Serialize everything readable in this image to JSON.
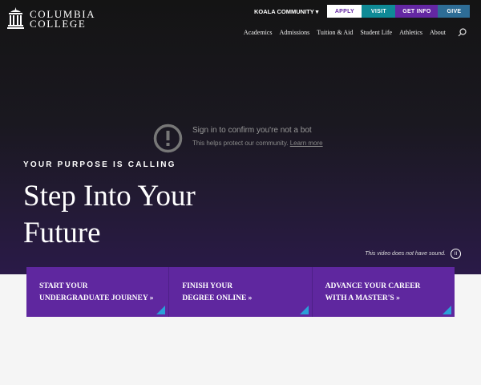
{
  "header": {
    "logo_line1": "COLUMBIA",
    "logo_line2": "COLLEGE",
    "community": "KOALA COMMUNITY ▾",
    "buttons": [
      {
        "label": "APPLY",
        "bg": "#ffffff",
        "fg": "#6427a3"
      },
      {
        "label": "VISIT",
        "bg": "#0f8a96",
        "fg": "#ffffff"
      },
      {
        "label": "GET INFO",
        "bg": "#6427a3",
        "fg": "#ffffff"
      },
      {
        "label": "GIVE",
        "bg": "#2e6d96",
        "fg": "#ffffff"
      }
    ],
    "nav": [
      "Academics",
      "Admissions",
      "Tuition & Aid",
      "Student Life",
      "Athletics",
      "About"
    ]
  },
  "video": {
    "title": "Sign in to confirm you're not a bot",
    "subtitle": "This helps protect our community.",
    "link": "Learn more",
    "sound_note": "This video does not have sound."
  },
  "hero": {
    "eyebrow": "YOUR PURPOSE IS CALLING",
    "line1": "Step Into Your",
    "line2": "Future"
  },
  "cards": [
    {
      "line1": "START YOUR",
      "line2": "UNDERGRADUATE JOURNEY »"
    },
    {
      "line1": "FINISH YOUR",
      "line2": "DEGREE ONLINE »"
    },
    {
      "line1": "ADVANCE YOUR CAREER",
      "line2": "WITH A MASTER'S »"
    }
  ]
}
